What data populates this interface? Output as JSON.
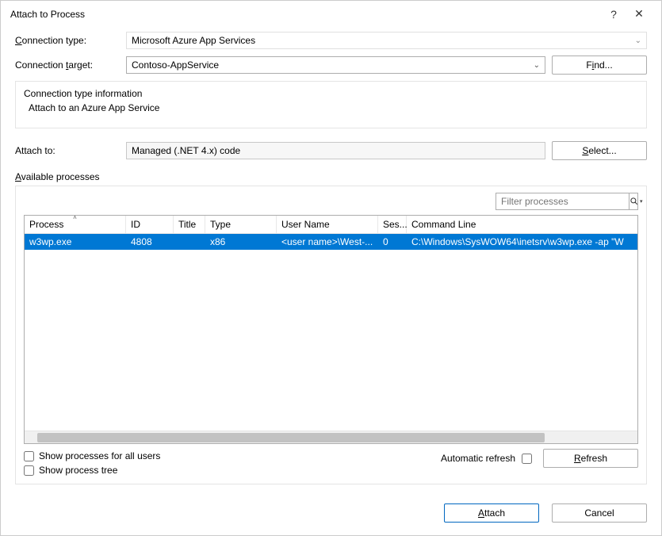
{
  "titlebar": {
    "title": "Attach to Process",
    "help": "?",
    "close": "✕"
  },
  "connectionType": {
    "label_pre": "C",
    "label_post": "onnection type:",
    "value": "Microsoft Azure App Services"
  },
  "connectionTarget": {
    "label_pre": "Connection ",
    "label_u": "t",
    "label_post": "arget:",
    "value": "Contoso-AppService",
    "find_pre": "F",
    "find_u": "i",
    "find_post": "nd..."
  },
  "infoBox": {
    "title": "Connection type information",
    "sub": "Attach to an Azure App Service"
  },
  "attachTo": {
    "label": "Attach to:",
    "value": "Managed (.NET 4.x) code",
    "select_u": "S",
    "select_post": "elect..."
  },
  "available": {
    "label_u": "A",
    "label_post": "vailable processes"
  },
  "filter": {
    "placeholder": "Filter processes"
  },
  "columns": {
    "process": "Process",
    "id": "ID",
    "title": "Title",
    "type": "Type",
    "user": "User Name",
    "session": "Ses...",
    "cmd": "Command Line"
  },
  "rows": [
    {
      "process": "w3wp.exe",
      "id": "4808",
      "title": "",
      "type": "x86",
      "user": "<user name>\\West-...",
      "session": "0",
      "cmd": "C:\\Windows\\SysWOW64\\inetsrv\\w3wp.exe -ap \"W"
    }
  ],
  "checks": {
    "allUsers_pre": "Show processes for all ",
    "allUsers_u": "u",
    "allUsers_post": "sers",
    "tree": "Show process tree"
  },
  "autoRefresh": "Automatic refresh",
  "refresh_u": "R",
  "refresh_post": "efresh",
  "footer": {
    "attach_u": "A",
    "attach_post": "ttach",
    "cancel": "Cancel"
  }
}
